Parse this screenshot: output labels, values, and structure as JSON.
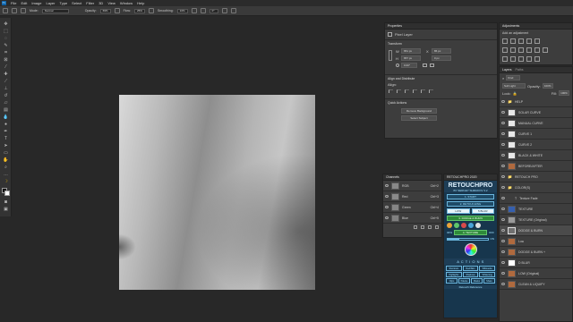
{
  "menubar": {
    "logo": "Ps",
    "items": [
      "File",
      "Edit",
      "Image",
      "Layer",
      "Type",
      "Select",
      "Filter",
      "3D",
      "View",
      "Window",
      "Help"
    ]
  },
  "options": {
    "mode_label": "Mode:",
    "mode_value": "Normal",
    "opacity_label": "Opacity:",
    "opacity_value": "69%",
    "flow_label": "Flow:",
    "flow_value": "25%",
    "smoothing_label": "Smoothing:",
    "smoothing_value": "10%",
    "angle_value": "0°"
  },
  "properties": {
    "tab": "Properties",
    "layer_type": "Pixel Layer",
    "transform_title": "Transform",
    "w_label": "W",
    "w_value": "651 px",
    "x_label": "X",
    "x_value": "86 px",
    "h_label": "H",
    "h_value": "657 px",
    "y_value": "0 px",
    "angle_value": "0.00°",
    "align_title": "Align and Distribute",
    "align_label": "Align:",
    "quick_actions_title": "Quick Actions",
    "remove_bg_label": "Remove Background",
    "select_subject_label": "Select Subject"
  },
  "adjustments": {
    "tab": "Adjustments",
    "subtitle": "Add an adjustment"
  },
  "channels": {
    "tab": "Channels",
    "items": [
      {
        "name": "RGB",
        "shortcut": "Ctrl+2"
      },
      {
        "name": "Red",
        "shortcut": "Ctrl+3"
      },
      {
        "name": "Green",
        "shortcut": "Ctrl+4"
      },
      {
        "name": "Blue",
        "shortcut": "Ctrl+5"
      }
    ]
  },
  "retouchpro": {
    "tab_title": "RETOUCHPRO 2020",
    "brand": "RETOUCHPRO",
    "author": "BY SERGEY SHMAKOV 3.2",
    "step1": "1. START",
    "step2": "2. RETOUCHING",
    "low_label": "LOW",
    "blur_label": "5 BLUR",
    "step3": "3. DODGE & BURN",
    "step4_label": "4. TEXTURE",
    "texture_pct": "30%",
    "off_label": "OFF",
    "on_label": "ON",
    "actions_label": "A C T I O N S",
    "row1": [
      "Shortcuts",
      "Red/Skin",
      "Silhouette"
    ],
    "row2": [
      "Highlights",
      "Shadows",
      "Whitening"
    ],
    "row3": [
      "Clips",
      "Palette",
      "Masks",
      "Share"
    ],
    "footer": "Retouch Reference"
  },
  "colors": {
    "accent_blue": "#6bb6dd",
    "retouch_bg": "#17364d",
    "dodge_burn_green": "#2f8a3a"
  },
  "layers": {
    "tabs": [
      "Layers",
      "Paths"
    ],
    "kind_label": "Kind",
    "blend_mode": "Soft Light",
    "opacity_label": "Opacity:",
    "opacity_value": "100%",
    "fill_label": "Fill:",
    "fill_value": "100%",
    "lock_label": "Lock:",
    "items": [
      {
        "name": "HELP",
        "kind": "group"
      },
      {
        "name": "SOLAR CURVE",
        "kind": "adjust"
      },
      {
        "name": "MANUAL CURVE",
        "kind": "adjust"
      },
      {
        "name": "CURVE 1",
        "kind": "adjust"
      },
      {
        "name": "CURVE 2",
        "kind": "adjust"
      },
      {
        "name": "BLACK & WHITE",
        "kind": "adjust"
      },
      {
        "name": "BEFORE/AFTER",
        "kind": "skin"
      },
      {
        "name": "RETOUCH PRO",
        "kind": "group"
      },
      {
        "name": "COLOR(S)",
        "kind": "group"
      },
      {
        "name": "Texture Fade",
        "kind": "text"
      },
      {
        "name": "TEXTURE",
        "kind": "blue"
      },
      {
        "name": "TEXTURE (Original)",
        "kind": "gray"
      },
      {
        "name": "DODGE & BURN",
        "kind": "dodge"
      },
      {
        "name": "Low",
        "kind": "skin"
      },
      {
        "name": "DODGE & BURN +",
        "kind": "skin"
      },
      {
        "name": "D BLUR",
        "kind": "mask"
      },
      {
        "name": "LOW (Original)",
        "kind": "skin"
      },
      {
        "name": "CLEAN & LIQUIFY",
        "kind": "skin"
      }
    ]
  }
}
